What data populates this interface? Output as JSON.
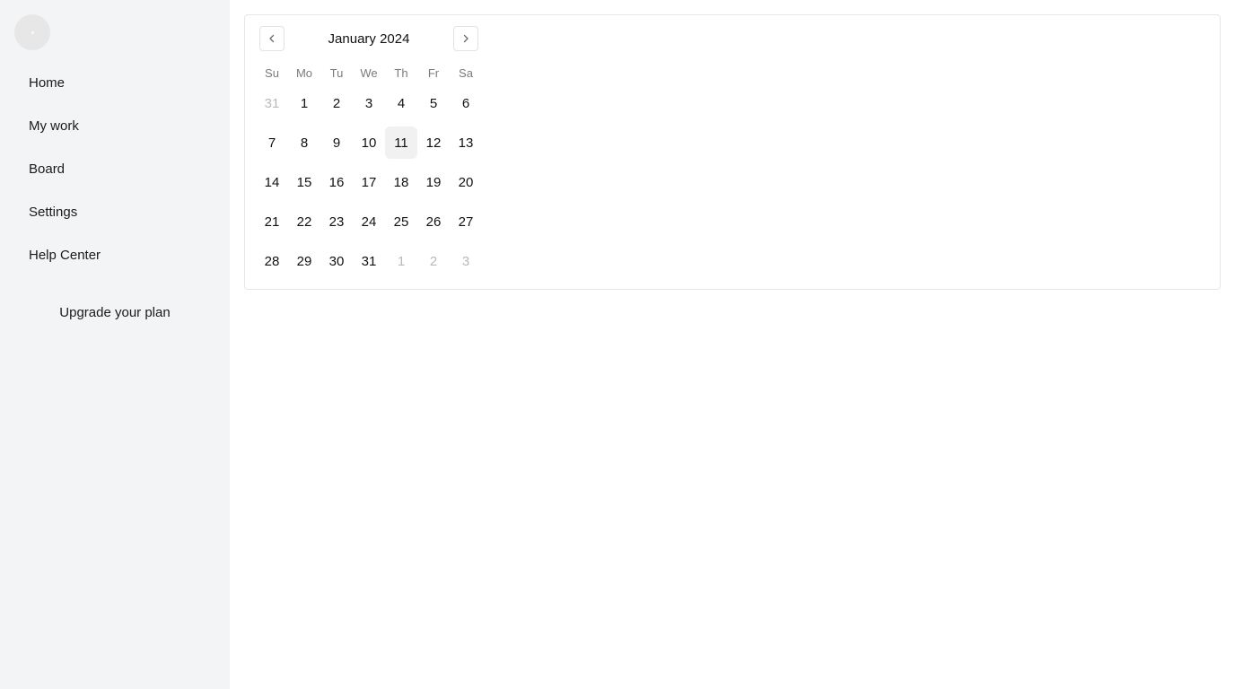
{
  "sidebar": {
    "items": [
      {
        "label": "Home"
      },
      {
        "label": "My work"
      },
      {
        "label": "Board"
      },
      {
        "label": "Settings"
      },
      {
        "label": "Help Center"
      }
    ],
    "upgrade_label": "Upgrade your plan"
  },
  "calendar": {
    "month_label": "January 2024",
    "weekdays": [
      "Su",
      "Mo",
      "Tu",
      "We",
      "Th",
      "Fr",
      "Sa"
    ],
    "selected_day": "11",
    "weeks": [
      [
        {
          "d": "31",
          "muted": true
        },
        {
          "d": "1"
        },
        {
          "d": "2"
        },
        {
          "d": "3"
        },
        {
          "d": "4"
        },
        {
          "d": "5"
        },
        {
          "d": "6"
        }
      ],
      [
        {
          "d": "7"
        },
        {
          "d": "8"
        },
        {
          "d": "9"
        },
        {
          "d": "10"
        },
        {
          "d": "11",
          "today": true
        },
        {
          "d": "12"
        },
        {
          "d": "13"
        }
      ],
      [
        {
          "d": "14"
        },
        {
          "d": "15"
        },
        {
          "d": "16"
        },
        {
          "d": "17"
        },
        {
          "d": "18"
        },
        {
          "d": "19"
        },
        {
          "d": "20"
        }
      ],
      [
        {
          "d": "21"
        },
        {
          "d": "22"
        },
        {
          "d": "23"
        },
        {
          "d": "24"
        },
        {
          "d": "25"
        },
        {
          "d": "26"
        },
        {
          "d": "27"
        }
      ],
      [
        {
          "d": "28"
        },
        {
          "d": "29"
        },
        {
          "d": "30"
        },
        {
          "d": "31"
        },
        {
          "d": "1",
          "muted": true
        },
        {
          "d": "2",
          "muted": true
        },
        {
          "d": "3",
          "muted": true
        }
      ]
    ],
    "prev_icon": "chevron-left-icon",
    "next_icon": "chevron-right-icon"
  },
  "colors": {
    "sidebar_bg": "#f3f4f5",
    "today_bg": "#f1f1f1",
    "muted_text": "#b9b9b9"
  }
}
